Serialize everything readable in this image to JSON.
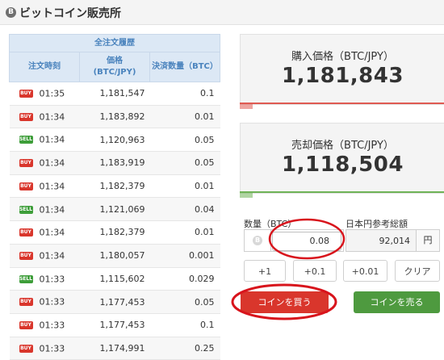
{
  "header": {
    "title": "ビットコイン販売所",
    "logo_text": "B"
  },
  "history": {
    "caption": "全注文履歴",
    "columns": [
      "注文時刻",
      "価格\n(BTC/JPY)",
      "決済数量（BTC）"
    ],
    "rows": [
      {
        "side": "BUY",
        "time": "01:35",
        "price": "1,181,547",
        "amount": "0.1"
      },
      {
        "side": "BUY",
        "time": "01:34",
        "price": "1,183,892",
        "amount": "0.01"
      },
      {
        "side": "SELL",
        "time": "01:34",
        "price": "1,120,963",
        "amount": "0.05"
      },
      {
        "side": "BUY",
        "time": "01:34",
        "price": "1,183,919",
        "amount": "0.05"
      },
      {
        "side": "BUY",
        "time": "01:34",
        "price": "1,182,379",
        "amount": "0.01"
      },
      {
        "side": "SELL",
        "time": "01:34",
        "price": "1,121,069",
        "amount": "0.04"
      },
      {
        "side": "BUY",
        "time": "01:34",
        "price": "1,182,379",
        "amount": "0.01"
      },
      {
        "side": "BUY",
        "time": "01:34",
        "price": "1,180,057",
        "amount": "0.001"
      },
      {
        "side": "SELL",
        "time": "01:33",
        "price": "1,115,602",
        "amount": "0.029"
      },
      {
        "side": "BUY",
        "time": "01:33",
        "price": "1,177,453",
        "amount": "0.05"
      },
      {
        "side": "BUY",
        "time": "01:33",
        "price": "1,177,453",
        "amount": "0.1"
      },
      {
        "side": "BUY",
        "time": "01:33",
        "price": "1,174,991",
        "amount": "0.25"
      }
    ]
  },
  "buy_price": {
    "label": "購入価格（BTC/JPY）",
    "value": "1,181,843",
    "bar_color": "#e05a52"
  },
  "sell_price": {
    "label": "売却価格（BTC/JPY）",
    "value": "1,118,504",
    "bar_color": "#6fb356"
  },
  "form": {
    "amount_label": "数量（BTC）",
    "amount_value": "0.08",
    "coin_icon": "B",
    "jpy_label": "日本円参考総額",
    "jpy_value": "92,014",
    "jpy_unit": "円"
  },
  "steps": {
    "plus1": "+1",
    "plus01": "+0.1",
    "plus001": "+0.01",
    "clear": "クリア"
  },
  "actions": {
    "buy": "コインを買う",
    "sell": "コインを売る",
    "buy_color": "#d9362c",
    "sell_color": "#4e9a3f"
  },
  "colors": {
    "annotation": "#d8141c"
  }
}
